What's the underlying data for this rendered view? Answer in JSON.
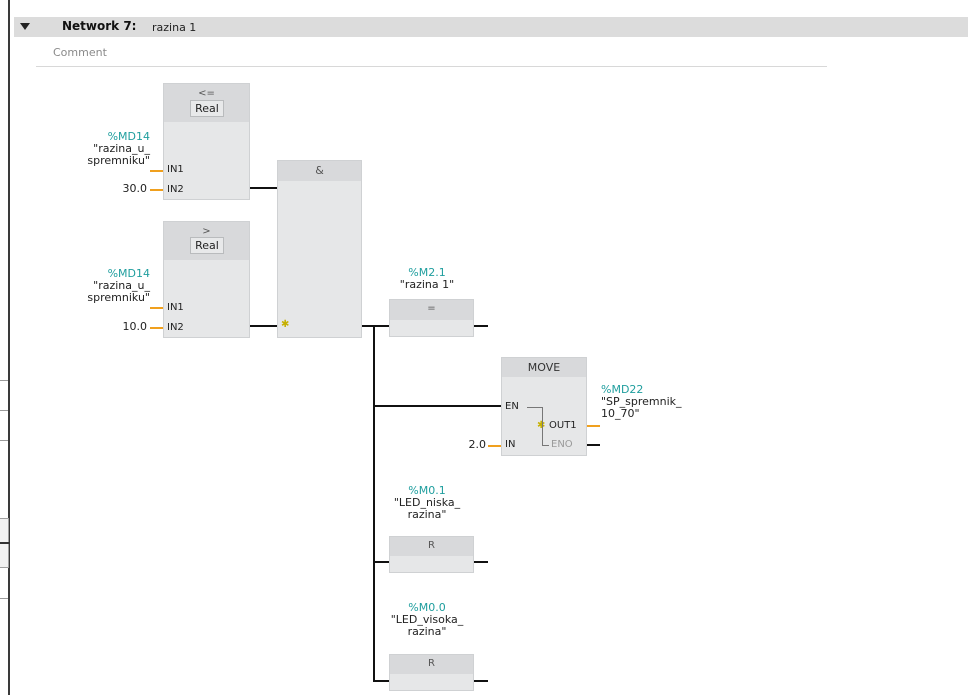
{
  "network": {
    "title": "Network 7:",
    "name": "razina 1",
    "comment_placeholder": "Comment"
  },
  "cmp_le": {
    "symbol": "<=",
    "type": "Real",
    "operand": {
      "address": "%MD14",
      "name_line1": "\"razina_u_",
      "name_line2": "spremniku\""
    },
    "in1": "IN1",
    "in2": "IN2",
    "in2_value": "30.0"
  },
  "cmp_gt": {
    "symbol": ">",
    "type": "Real",
    "operand": {
      "address": "%MD14",
      "name_line1": "\"razina_u_",
      "name_line2": "spremniku\""
    },
    "in1": "IN1",
    "in2": "IN2",
    "in2_value": "10.0"
  },
  "and_box": {
    "symbol": "&"
  },
  "coil_assign": {
    "address": "%M2.1",
    "name": "\"razina 1\"",
    "symbol": "="
  },
  "move_box": {
    "title": "MOVE",
    "en": "EN",
    "in": "IN",
    "in_value": "2.0",
    "out1": "OUT1",
    "eno": "ENO",
    "out_address": "%MD22",
    "out_name_line1": "\"SP_spremnik_",
    "out_name_line2": "10_70\""
  },
  "reset_1": {
    "address": "%M0.1",
    "name_line1": "\"LED_niska_",
    "name_line2": "razina\"",
    "symbol": "R"
  },
  "reset_2": {
    "address": "%M0.0",
    "name_line1": "\"LED_visoka_",
    "name_line2": "razina\"",
    "symbol": "R"
  },
  "colors": {
    "address": "#1f9e9e",
    "constant": "#3a6fb4",
    "wire_pin": "#f0a01e",
    "box": "#e6e7e8"
  }
}
